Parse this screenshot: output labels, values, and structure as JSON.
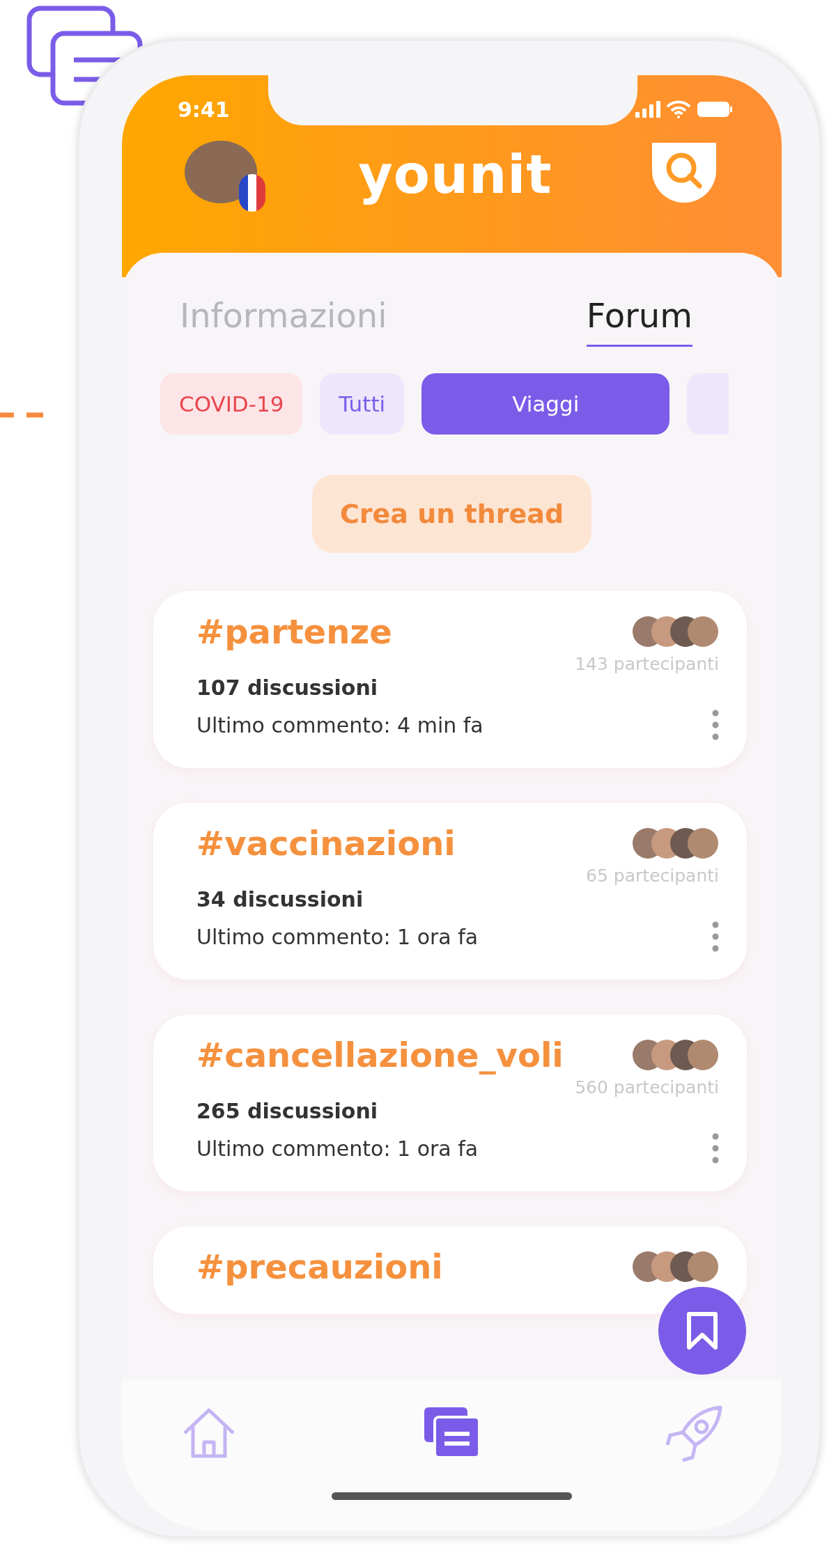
{
  "status_bar": {
    "time": "9:41"
  },
  "header": {
    "logo": "younit"
  },
  "tabs": [
    {
      "label": "Informazioni",
      "selected": false
    },
    {
      "label": "Forum",
      "selected": true
    }
  ],
  "chips": [
    {
      "label": "COVID-19",
      "selected": false,
      "kind": "alert"
    },
    {
      "label": "Tutti",
      "selected": false,
      "kind": "topic"
    },
    {
      "label": "Viaggi",
      "selected": true,
      "kind": "topic"
    }
  ],
  "create_button": "Crea un thread",
  "threads": [
    {
      "title": "#partenze",
      "participants": "143 partecipanti",
      "discussions": "107 discussioni",
      "last_comment": "Ultimo commento: 4 min fa"
    },
    {
      "title": "#vaccinazioni",
      "participants": "65 partecipanti",
      "discussions": "34 discussioni",
      "last_comment": "Ultimo commento: 1 ora fa"
    },
    {
      "title": "#cancellazione_voli",
      "participants": "560 partecipanti",
      "discussions": "265 discussioni",
      "last_comment": "Ultimo commento: 1 ora fa"
    },
    {
      "title": "#precauzioni"
    }
  ],
  "bottom_nav": [
    {
      "kind": "home",
      "selected": false
    },
    {
      "kind": "forum",
      "selected": true
    },
    {
      "kind": "rocket",
      "selected": false
    }
  ]
}
